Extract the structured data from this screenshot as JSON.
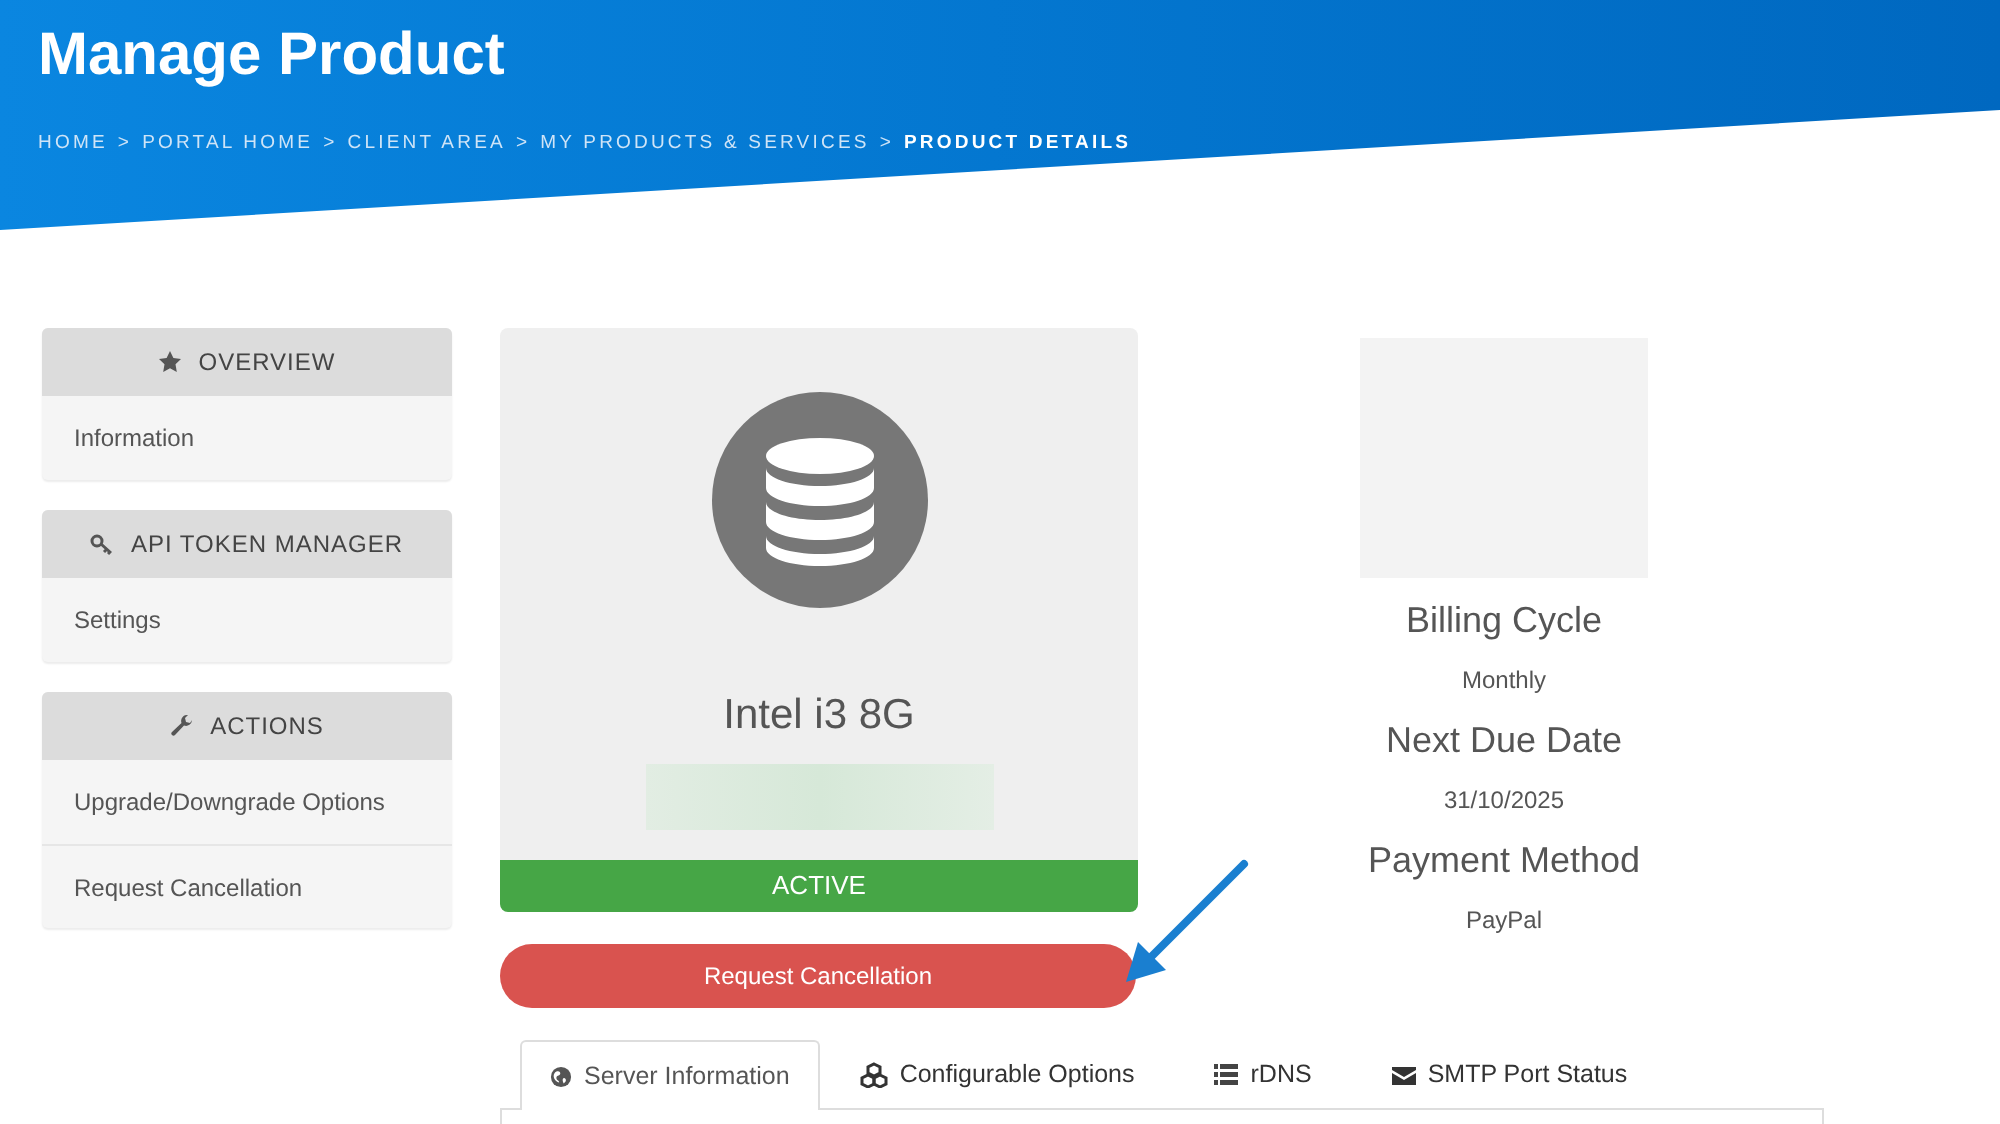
{
  "header": {
    "title": "Manage Product",
    "breadcrumb": [
      {
        "label": "HOME",
        "current": false
      },
      {
        "label": "PORTAL HOME",
        "current": false
      },
      {
        "label": "CLIENT AREA",
        "current": false
      },
      {
        "label": "MY PRODUCTS & SERVICES",
        "current": false
      },
      {
        "label": "PRODUCT DETAILS",
        "current": true
      }
    ],
    "separator": ">"
  },
  "sidebar": [
    {
      "kind": "star",
      "title": "OVERVIEW",
      "items": [
        "Information"
      ]
    },
    {
      "kind": "key",
      "title": "API TOKEN MANAGER",
      "items": [
        "Settings"
      ]
    },
    {
      "kind": "wrench",
      "title": "ACTIONS",
      "items": [
        "Upgrade/Downgrade Options",
        "Request Cancellation"
      ]
    }
  ],
  "product": {
    "name": "Intel i3 8G",
    "status": "ACTIVE",
    "action": "Request Cancellation"
  },
  "details": [
    {
      "label": "Billing Cycle",
      "value": "Monthly"
    },
    {
      "label": "Next Due Date",
      "value": "31/10/2025"
    },
    {
      "label": "Payment Method",
      "value": "PayPal"
    }
  ],
  "tabs": [
    {
      "kind": "globe",
      "label": "Server Information",
      "selected": true
    },
    {
      "kind": "cubes",
      "label": "Configurable Options",
      "selected": false
    },
    {
      "kind": "list",
      "label": "rDNS",
      "selected": false
    },
    {
      "kind": "envelope",
      "label": "SMTP Port Status",
      "selected": false
    }
  ]
}
